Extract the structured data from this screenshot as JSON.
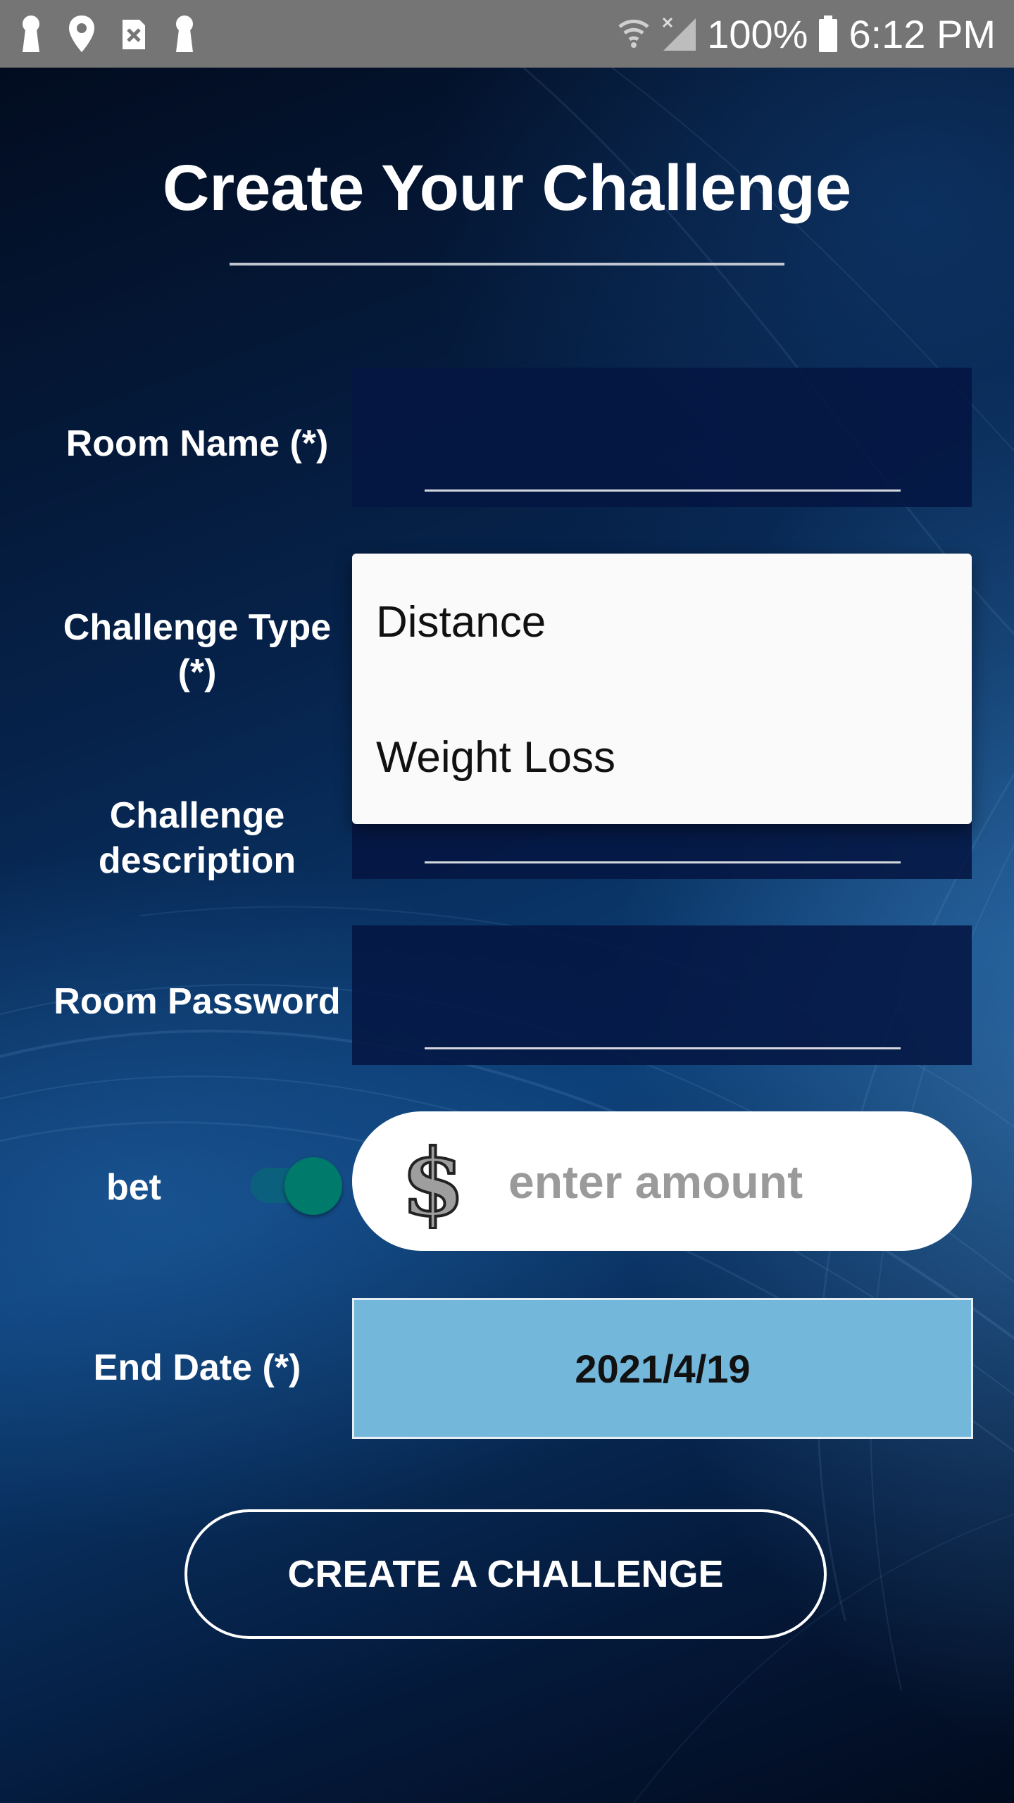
{
  "status_bar": {
    "battery": "100%",
    "time": "6:12 PM",
    "left_icons": [
      "keyhole-icon",
      "location-pin-icon",
      "close-square-icon",
      "keyhole-icon"
    ],
    "right_icons": [
      "wifi-icon",
      "signal-icon",
      "battery-icon"
    ]
  },
  "page": {
    "title": "Create Your Challenge"
  },
  "form": {
    "room_name": {
      "label": "Room Name (*)",
      "value": ""
    },
    "challenge_type": {
      "label": "Challenge Type (*)",
      "options": [
        "Distance",
        "Weight Loss"
      ]
    },
    "challenge_description": {
      "label": "Challenge description",
      "value": ""
    },
    "room_password": {
      "label": "Room Password",
      "value": ""
    },
    "bet": {
      "label": "bet",
      "toggle_on": true,
      "currency_symbol": "$",
      "amount_placeholder": "enter amount"
    },
    "end_date": {
      "label": "End Date (*)",
      "value": "2021/4/19"
    }
  },
  "actions": {
    "create_label": "CREATE A CHALLENGE"
  },
  "colors": {
    "status_bar": "#757575",
    "toggle_accent": "#007a6a",
    "date_fill": "#73b7da",
    "field_fill": "#051642"
  }
}
